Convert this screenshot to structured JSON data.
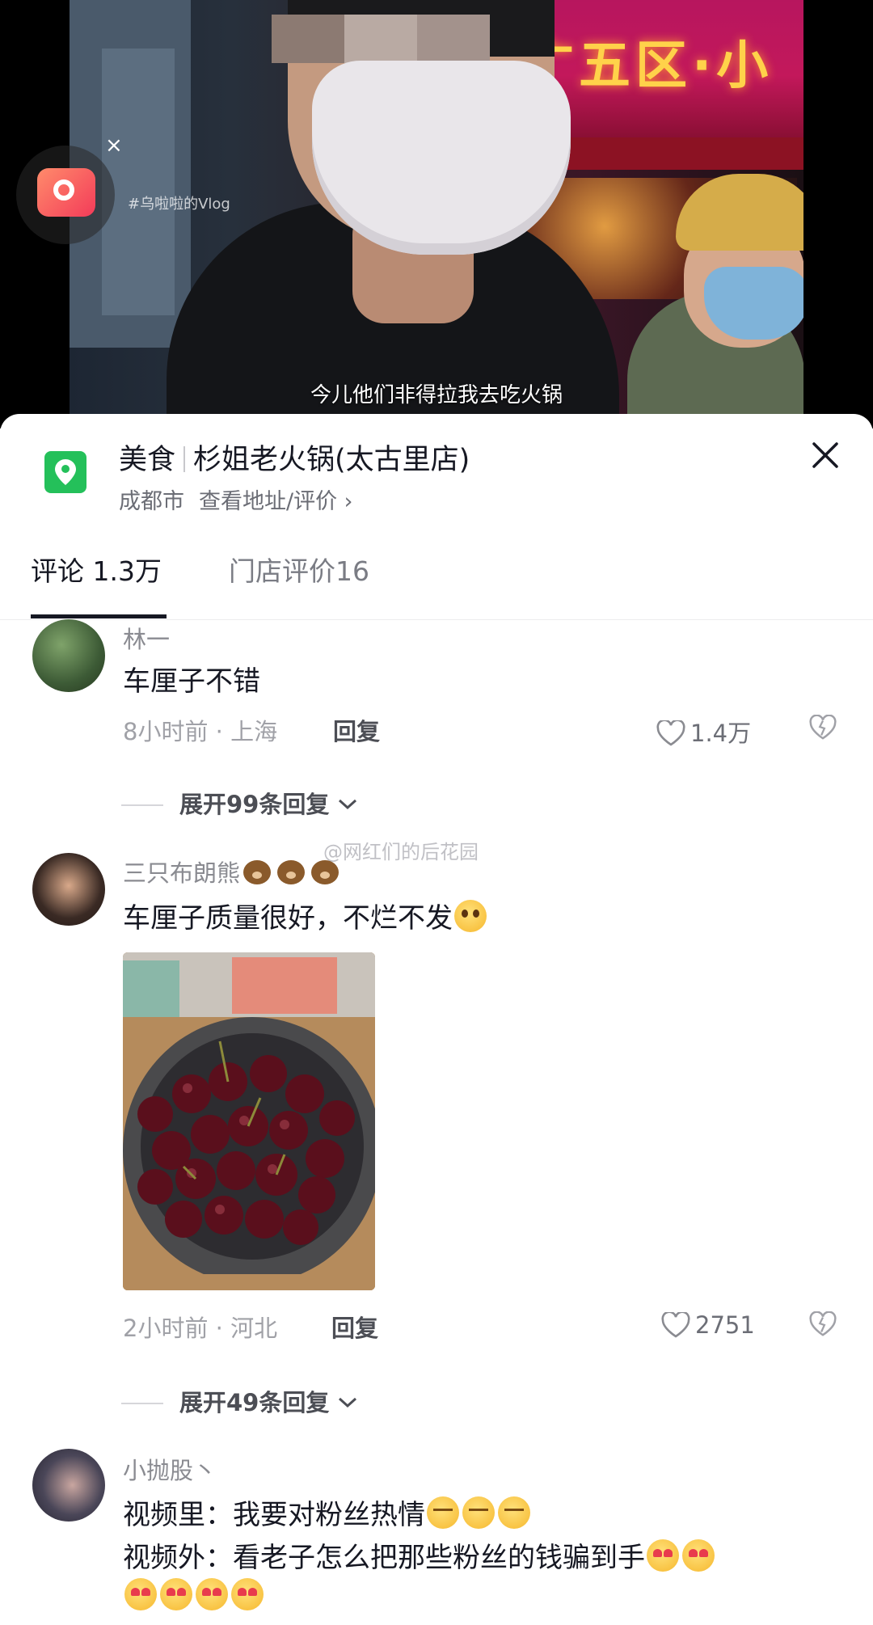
{
  "video": {
    "hashtag": "#乌啦啦的Vlog",
    "subtitle": "今儿他们非得拉我去吃火锅",
    "storefront_sign": "广五区·小",
    "music_close": "×"
  },
  "poi": {
    "category": "美食",
    "name": "杉姐老火锅(太古里店)",
    "city": "成都市",
    "link": "查看地址/评价 ›"
  },
  "tabs": [
    {
      "label": "评论 1.3万",
      "active": true
    },
    {
      "label": "门店评价16",
      "active": false
    }
  ],
  "watermark": "@网红们的后花园",
  "comments": [
    {
      "username": "林一",
      "text": "车厘子不错",
      "time_location": "8小时前 · 上海",
      "reply_label": "回复",
      "likes": "1.4万",
      "expand": "展开99条回复"
    },
    {
      "username": "三只布朗熊",
      "text": "车厘子质量很好，不烂不发",
      "time_location": "2小时前 · 河北",
      "reply_label": "回复",
      "likes": "2751",
      "expand": "展开49条回复"
    },
    {
      "username": "小抛股丶",
      "line1": "视频里：我要对粉丝热情",
      "line2": "视频外：看老子怎么把那些粉丝的钱骗到手"
    }
  ],
  "colors": {
    "poi_green": "#24c05a",
    "text_primary": "#161823",
    "text_secondary": "#8a8b91"
  }
}
